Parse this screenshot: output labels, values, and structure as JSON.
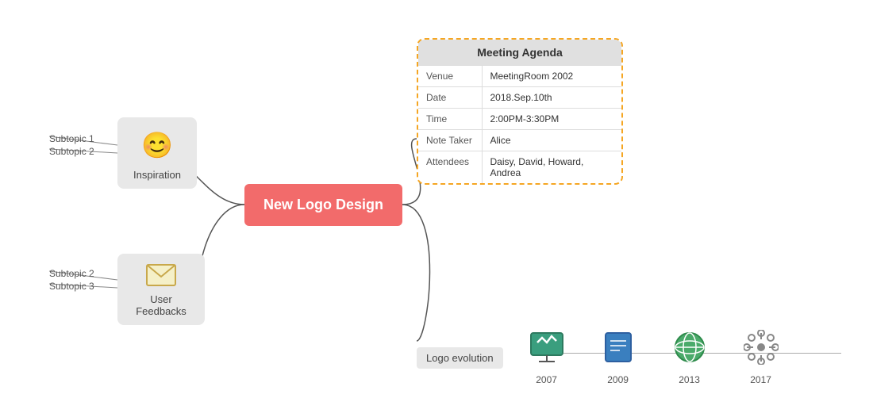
{
  "central": {
    "label": "New Logo Design"
  },
  "branches": {
    "inspiration": {
      "label": "Inspiration",
      "icon": "😊",
      "subtopics": [
        "Subtopic 1",
        "Subtopic 2"
      ]
    },
    "feedbacks": {
      "label": "User Feedbacks",
      "icon": "✉",
      "subtopics": [
        "Subtopic 2",
        "Subtopic 3"
      ]
    }
  },
  "agenda": {
    "title": "Meeting Agenda",
    "rows": [
      {
        "key": "Venue",
        "value": "MeetingRoom 2002"
      },
      {
        "key": "Date",
        "value": "2018.Sep.10th"
      },
      {
        "key": "Time",
        "value": "2:00PM-3:30PM"
      },
      {
        "key": "Note Taker",
        "value": "Alice"
      },
      {
        "key": "Attendees",
        "value": "Daisy, David, Howard, Andrea"
      }
    ]
  },
  "logo_evolution": {
    "label": "Logo evolution",
    "items": [
      {
        "year": "2007",
        "icon": "🖥"
      },
      {
        "year": "2009",
        "icon": "📗"
      },
      {
        "year": "2013",
        "icon": "🌍"
      },
      {
        "year": "2017",
        "icon": "⚛"
      }
    ]
  }
}
